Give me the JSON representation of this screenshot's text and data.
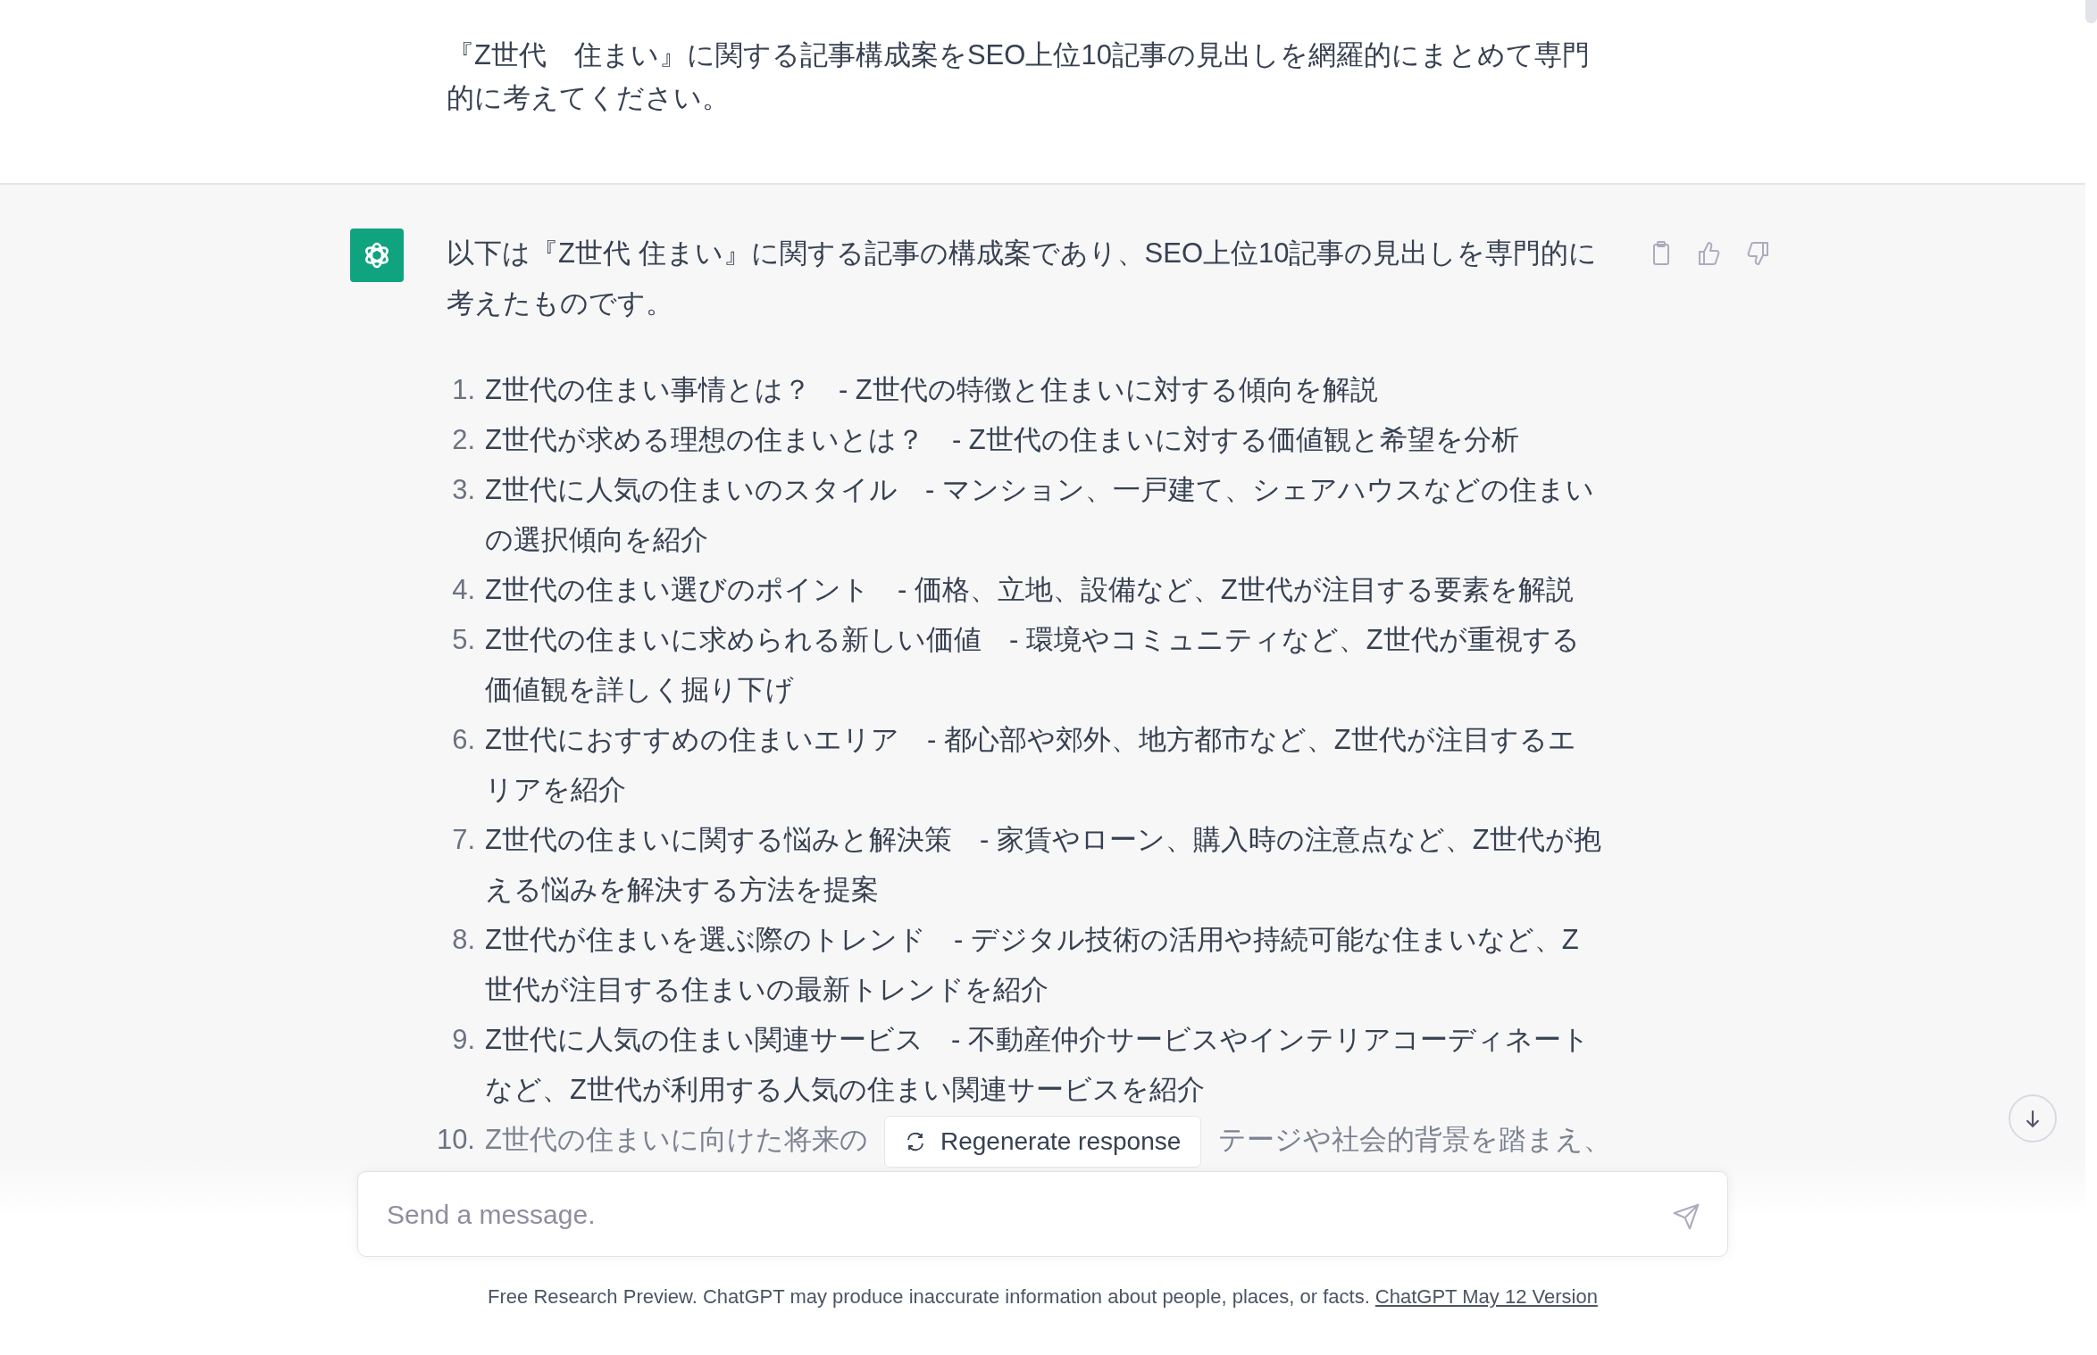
{
  "user_message": {
    "text": "『Z世代　住まい』に関する記事構成案をSEO上位10記事の見出しを網羅的にまとめて専門的に考えてください。"
  },
  "assistant_message": {
    "intro": "以下は『Z世代 住まい』に関する記事の構成案であり、SEO上位10記事の見出しを専門的に考えたものです。",
    "items": [
      {
        "number": "1.",
        "text": "Z世代の住まい事情とは？　- Z世代の特徴と住まいに対する傾向を解説"
      },
      {
        "number": "2.",
        "text": "Z世代が求める理想の住まいとは？　- Z世代の住まいに対する価値観と希望を分析"
      },
      {
        "number": "3.",
        "text": "Z世代に人気の住まいのスタイル　- マンション、一戸建て、シェアハウスなどの住まいの選択傾向を紹介"
      },
      {
        "number": "4.",
        "text": "Z世代の住まい選びのポイント　- 価格、立地、設備など、Z世代が注目する要素を解説"
      },
      {
        "number": "5.",
        "text": "Z世代の住まいに求められる新しい価値　- 環境やコミュニティなど、Z世代が重視する価値観を詳しく掘り下げ"
      },
      {
        "number": "6.",
        "text": "Z世代におすすめの住まいエリア　- 都心部や郊外、地方都市など、Z世代が注目するエリアを紹介"
      },
      {
        "number": "7.",
        "text": "Z世代の住まいに関する悩みと解決策　- 家賃やローン、購入時の注意点など、Z世代が抱える悩みを解決する方法を提案"
      },
      {
        "number": "8.",
        "text": "Z世代が住まいを選ぶ際のトレンド　- デジタル技術の活用や持続可能な住まいなど、Z世代が注目する住まいの最新トレンドを紹介"
      },
      {
        "number": "9.",
        "text": "Z世代に人気の住まい関連サービス　- 不動産仲介サービスやインテリアコーディネートなど、Z世代が利用する人気の住まい関連サービスを紹介"
      },
      {
        "number": "10.",
        "text": "Z世代の住まいに向けた将来の",
        "text_after": "テージや社会的背景を踏まえ、"
      }
    ]
  },
  "regenerate_button": {
    "label": "Regenerate response"
  },
  "composer": {
    "placeholder": "Send a message."
  },
  "footer": {
    "text": "Free Research Preview. ChatGPT may produce inaccurate information about people, places, or facts.",
    "link": "ChatGPT May 12 Version"
  }
}
